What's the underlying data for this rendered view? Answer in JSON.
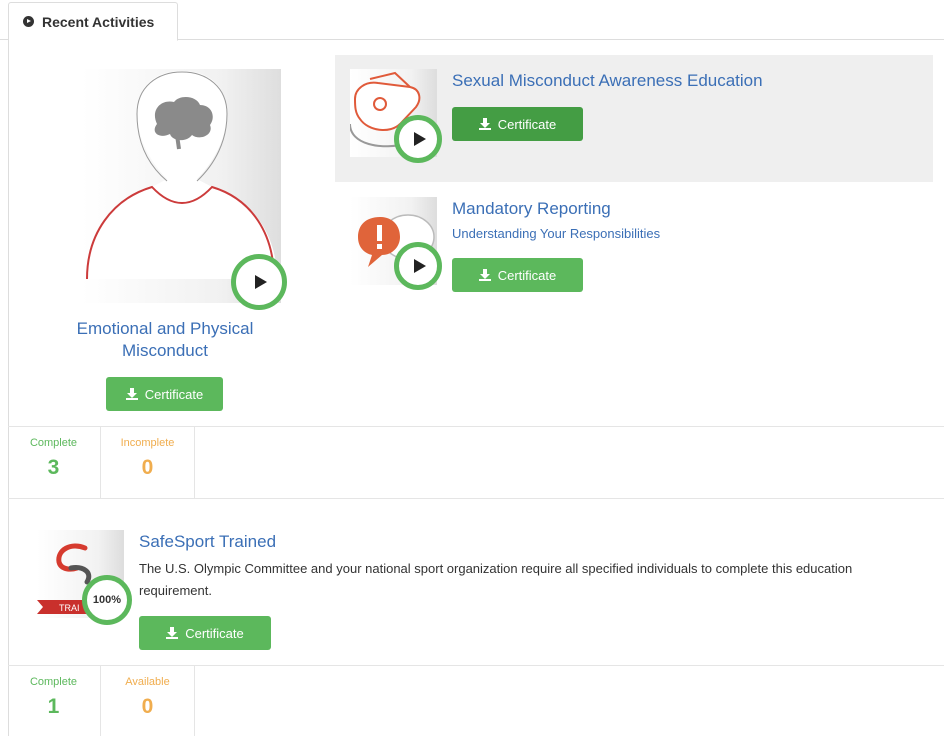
{
  "tab": {
    "label": "Recent Activities"
  },
  "courses": [
    {
      "title_line1": "Emotional and Physical",
      "title_line2": "Misconduct",
      "button": "Certificate"
    },
    {
      "title": "Sexual Misconduct Awareness Education",
      "button": "Certificate"
    },
    {
      "title": "Mandatory Reporting",
      "subtitle": "Understanding Your Responsibilities",
      "button": "Certificate"
    }
  ],
  "stats1": {
    "complete_label": "Complete",
    "complete_value": "3",
    "incomplete_label": "Incomplete",
    "incomplete_value": "0"
  },
  "safesport": {
    "title": "SafeSport Trained",
    "description": "The U.S. Olympic Committee and your national sport organization require all specified individuals to complete this education requirement.",
    "badge_percent": "100%",
    "ribbon_text": "TRAI",
    "button": "Certificate"
  },
  "stats2": {
    "complete_label": "Complete",
    "complete_value": "1",
    "available_label": "Available",
    "available_value": "0"
  },
  "colors": {
    "green": "#5cb85c",
    "dark_green": "#449d44",
    "link_blue": "#3b6fb6",
    "orange": "#f0ad4e"
  }
}
